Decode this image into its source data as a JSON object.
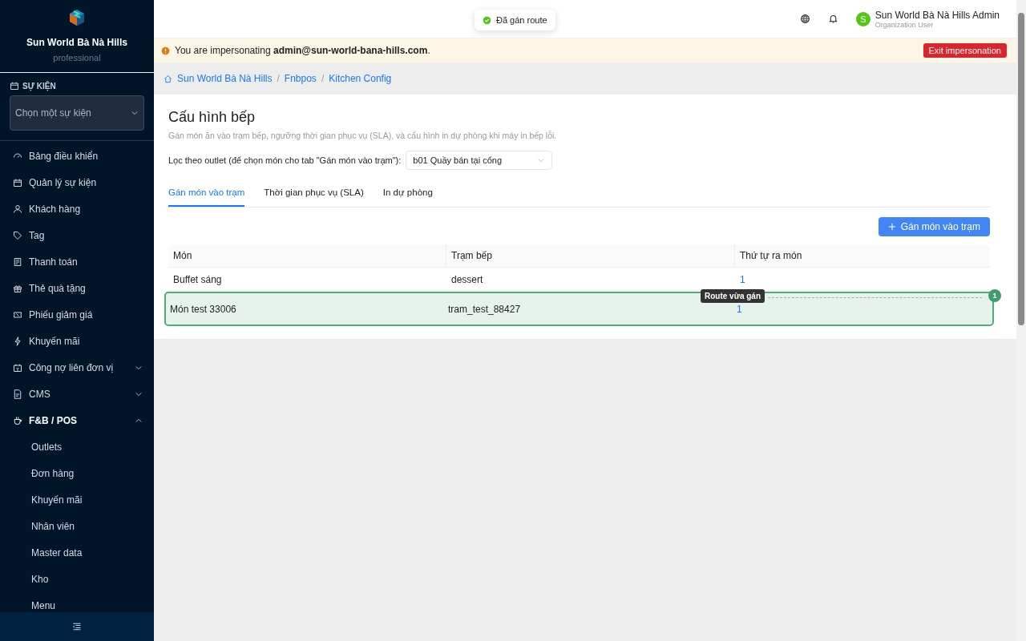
{
  "sidebar": {
    "brand": "Sun World Bà Nà Hills",
    "plan": "professional",
    "event_section": {
      "label": "SỰ KIỆN",
      "select_placeholder": "Chọn một sự kiện"
    },
    "items": [
      {
        "label": "Bảng điều khiển"
      },
      {
        "label": "Quản lý sự kiện"
      },
      {
        "label": "Khách hàng"
      },
      {
        "label": "Tag"
      },
      {
        "label": "Thanh toán"
      },
      {
        "label": "Thẻ quà tặng"
      },
      {
        "label": "Phiếu giảm giá"
      },
      {
        "label": "Khuyến mãi"
      },
      {
        "label": "Công nợ liên đơn vị",
        "expanded": false
      },
      {
        "label": "CMS",
        "expanded": false
      },
      {
        "label": "F&B / POS",
        "expanded": true,
        "children": [
          {
            "label": "Outlets"
          },
          {
            "label": "Đơn hàng"
          },
          {
            "label": "Khuyến mãi"
          },
          {
            "label": "Nhân viên"
          },
          {
            "label": "Master data"
          },
          {
            "label": "Kho"
          },
          {
            "label": "Menu"
          }
        ]
      }
    ]
  },
  "toast": {
    "message": "Đã gán route"
  },
  "header": {
    "user_name": "Sun World Bà Nà Hills Admin",
    "user_role": "Organization User",
    "avatar_initial": "S"
  },
  "banner": {
    "text": "You are impersonating **admin@sun-world-bana-hills.com**.",
    "button": "Exit impersonation"
  },
  "breadcrumb": [
    "Sun World Bà Nà Hills",
    "Fnbpos",
    "Kitchen Config"
  ],
  "breadcrumb_separator": "/",
  "page": {
    "title": "Cấu hình bếp",
    "subtitle": "Gán món ăn vào trạm bếp, ngưỡng thời gian phục vụ (SLA), và cấu hình in dự phòng khi máy in bếp lỗi.",
    "filter_label": "Lọc theo outlet (để chọn món cho tab \"Gán món vào trạm\"):",
    "filter_value": "b01 Quầy bán tại cổng",
    "tabs": [
      {
        "label": "Gán món vào trạm",
        "selected": true
      },
      {
        "label": "Thời gian phục vụ (SLA)",
        "selected": false
      },
      {
        "label": "In dự phòng",
        "selected": false
      }
    ],
    "add_button": "Gán món vào trạm",
    "table": {
      "columns": [
        "Món",
        "Trạm bếp",
        "Thứ tự ra món"
      ],
      "rows": [
        {
          "cells": [
            "Buffet sáng",
            "dessert",
            "1"
          ],
          "highlighted": false
        },
        {
          "cells": [
            "Món test 33006",
            "tram_test_88427",
            "1"
          ],
          "highlighted": true
        }
      ]
    },
    "tour": {
      "tooltip": "Route vừa gán",
      "step": "1"
    }
  }
}
